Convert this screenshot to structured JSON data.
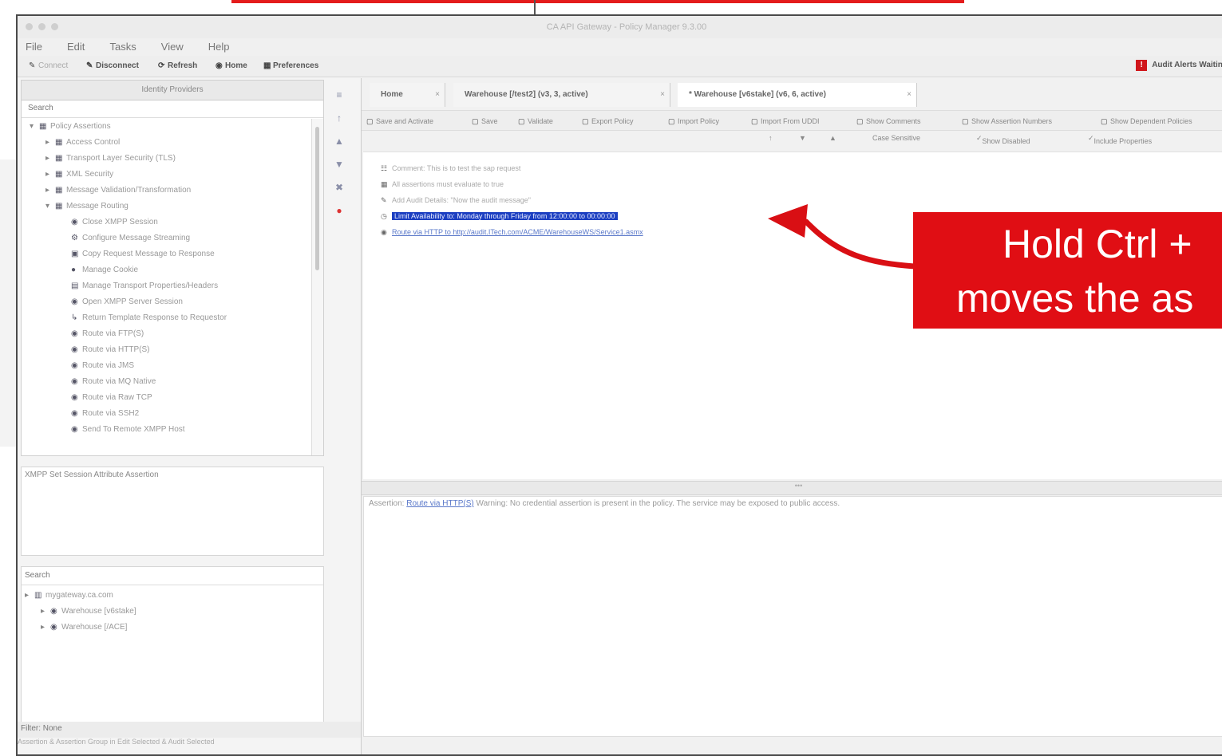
{
  "window": {
    "title": "CA API Gateway - Policy Manager 9.3.00"
  },
  "menu": [
    "File",
    "Edit",
    "Tasks",
    "View",
    "Help"
  ],
  "toolbar": {
    "items": [
      "Connect",
      "Disconnect",
      "Refresh",
      "Home",
      "Preferences"
    ],
    "audit_alert": "Audit Alerts Waiting"
  },
  "assertions_panel": {
    "header": "Identity Providers",
    "search_label": "Search",
    "tree": [
      {
        "label": "Policy Assertions",
        "level": 0,
        "icon": "folder-icon",
        "expanded": true
      },
      {
        "label": "Access Control",
        "level": 1,
        "icon": "folder-icon"
      },
      {
        "label": "Transport Layer Security (TLS)",
        "level": 1,
        "icon": "folder-icon"
      },
      {
        "label": "XML Security",
        "level": 1,
        "icon": "folder-icon"
      },
      {
        "label": "Message Validation/Transformation",
        "level": 1,
        "icon": "folder-icon"
      },
      {
        "label": "Message Routing",
        "level": 1,
        "icon": "folder-icon",
        "expanded": true
      },
      {
        "label": "Close XMPP Session",
        "level": 2,
        "icon": "globe-icon"
      },
      {
        "label": "Configure Message Streaming",
        "level": 2,
        "icon": "gear-icon"
      },
      {
        "label": "Copy Request Message to Response",
        "level": 2,
        "icon": "copy-icon"
      },
      {
        "label": "Manage Cookie",
        "level": 2,
        "icon": "cookie-icon"
      },
      {
        "label": "Manage Transport Properties/Headers",
        "level": 2,
        "icon": "document-icon"
      },
      {
        "label": "Open XMPP Server Session",
        "level": 2,
        "icon": "globe-icon"
      },
      {
        "label": "Return Template Response to Requestor",
        "level": 2,
        "icon": "arrow-icon"
      },
      {
        "label": "Route via FTP(S)",
        "level": 2,
        "icon": "globe-icon"
      },
      {
        "label": "Route via HTTP(S)",
        "level": 2,
        "icon": "globe-icon"
      },
      {
        "label": "Route via JMS",
        "level": 2,
        "icon": "globe-icon"
      },
      {
        "label": "Route via MQ Native",
        "level": 2,
        "icon": "globe-icon"
      },
      {
        "label": "Route via Raw TCP",
        "level": 2,
        "icon": "globe-icon"
      },
      {
        "label": "Route via SSH2",
        "level": 2,
        "icon": "globe-icon"
      },
      {
        "label": "Send To Remote XMPP Host",
        "level": 2,
        "icon": "globe-icon"
      }
    ],
    "description": "XMPP Set Session Attribute Assertion"
  },
  "services_panel": {
    "search_label": "Search",
    "tree": [
      {
        "label": "mygateway.ca.com",
        "level": 0,
        "icon": "server-icon"
      },
      {
        "label": "Warehouse [v6stake]",
        "level": 1,
        "icon": "globe-icon"
      },
      {
        "label": "Warehouse [/ACE]",
        "level": 1,
        "icon": "globe-icon"
      }
    ],
    "filter": "Filter: None",
    "status": "Assertion & Assertion Group in Edit Selected & Audit Selected"
  },
  "side_icons": [
    "collapse-icon",
    "up-icon",
    "move-up-icon",
    "move-down-icon",
    "delete-icon",
    "stop-icon"
  ],
  "tabs": [
    {
      "label": "Home"
    },
    {
      "label": "Warehouse [/test2] (v3, 3, active)"
    },
    {
      "label": "* Warehouse [v6stake] (v6, 6, active)"
    }
  ],
  "editor_toolbar": {
    "items": [
      "Save and Activate",
      "Save",
      "Validate",
      "Export Policy",
      "Import Policy",
      "Import From UDDI",
      "Show Comments",
      "Show Assertion Numbers",
      "Show Dependent Policies"
    ],
    "row2": [
      "Case Sensitive",
      "Show Disabled",
      "Include Properties"
    ]
  },
  "policy": [
    {
      "text": "Comment: This is to test the sap request",
      "icon": "comment-icon"
    },
    {
      "text": "All assertions must evaluate to true",
      "icon": "folder-icon"
    },
    {
      "text": "Add Audit Details: \"Now the audit message\"",
      "icon": "pencil-icon"
    },
    {
      "text": "Limit Availability to: Monday through Friday from 12:00:00 to 00:00:00",
      "icon": "clock-icon",
      "selected": true
    },
    {
      "text": "Route via HTTP to http://audit.ITech.com/ACME/WarehouseWS/Service1.asmx",
      "icon": "globe-icon",
      "link": true
    }
  ],
  "validation": {
    "prefix": "Assertion: ",
    "link": "Route via HTTP(S)",
    "message": " Warning: No credential assertion is present in the policy. The service may be exposed to public access."
  },
  "callout": {
    "line1": "Hold Ctrl +",
    "line2": "moves the as"
  },
  "colors": {
    "callout_red": "#e00e14",
    "selection_blue": "#1c3fc1"
  }
}
